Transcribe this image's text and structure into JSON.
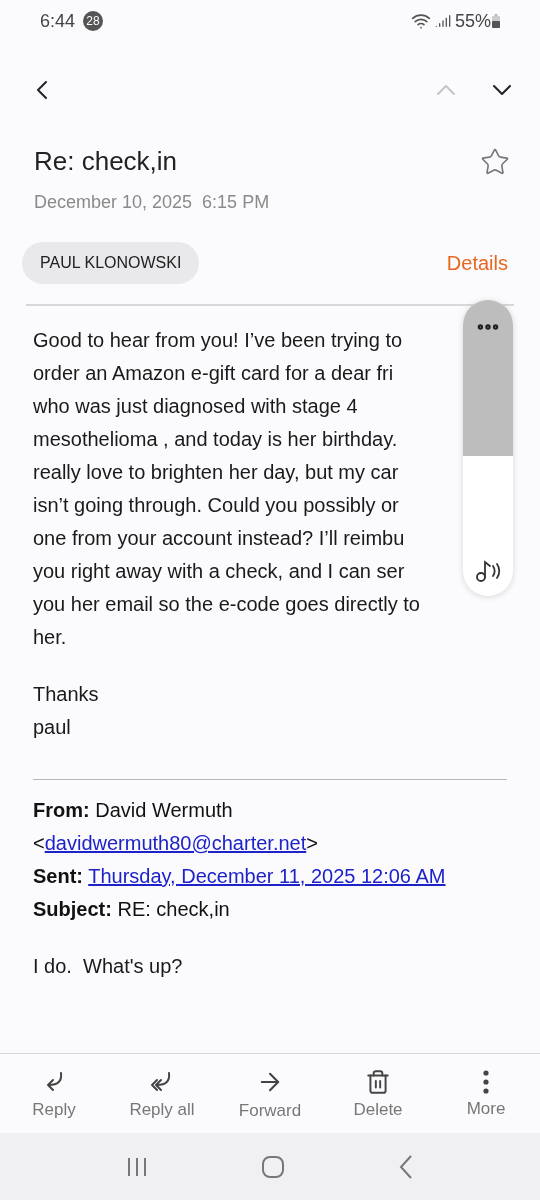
{
  "status_bar": {
    "time": "6:44",
    "notification_count": "28",
    "battery": "55%"
  },
  "nav_buttons": [
    {
      "kind": "back",
      "disabled": false
    },
    {
      "kind": "previous",
      "disabled": true
    },
    {
      "kind": "next",
      "disabled": false
    }
  ],
  "subject": "Re: check,in",
  "starred": false,
  "date": "December 10, 2025  6:15 PM",
  "sender_chip": "PAUL KLONOWSKI",
  "details_link": "Details",
  "body_lines": [
    "Good to hear from you! I’ve been trying to",
    "order an Amazon e-gift card for a dear fri",
    "who was just diagnosed with stage 4",
    "mesothelioma , and today is her birthday.",
    "really love to brighten her day, but my car",
    "isn’t going through. Could you possibly or",
    "one from your account instead? I’ll reimbu",
    "you right away with a check, and I can ser",
    "you her email so the e-code goes directly to",
    "her."
  ],
  "signature_lines": [
    "Thanks",
    "paul"
  ],
  "quoted_header": [
    {
      "label": "From:",
      "value": "David Wermuth",
      "link_prefix": "<",
      "link": "davidwermuth80@charter.net",
      "link_suffix": ">"
    },
    {
      "label": "Sent:",
      "link": "Thursday, December 11, 2025 12:06 AM"
    },
    {
      "label": "Subject:",
      "value": "RE: check,in"
    }
  ],
  "quoted_body": "I do.  What's up?",
  "actions": [
    {
      "kind": "reply",
      "label": "Reply"
    },
    {
      "kind": "reply_all",
      "label": "Reply all"
    },
    {
      "kind": "forward",
      "label": "Forward"
    },
    {
      "kind": "delete",
      "label": "Delete"
    },
    {
      "kind": "more",
      "label": "More"
    }
  ]
}
